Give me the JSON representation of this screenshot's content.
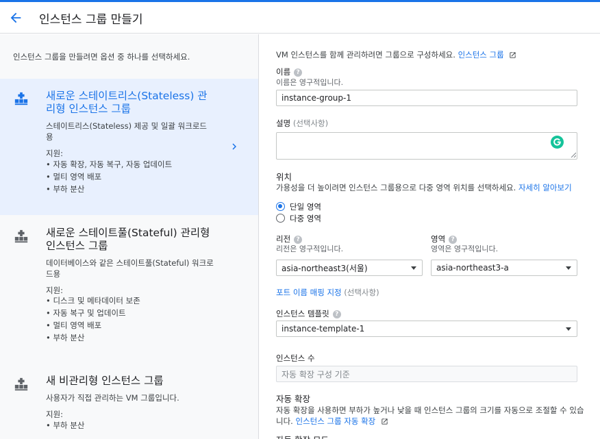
{
  "header": {
    "title": "인스턴스 그룹 만들기"
  },
  "left": {
    "intro": "인스턴스 그룹을 만들려면 옵션 중 하나를 선택하세요.",
    "options": [
      {
        "title": "새로운 스테이트리스(Stateless) 관리형 인스턴스 그룹",
        "desc": "스테이트리스(Stateless) 제공 및 일괄 워크로드용",
        "support": "지원:",
        "features": [
          "• 자동 확장, 자동 복구, 자동 업데이트",
          "• 멀티 영역 배포",
          "• 부하 분산"
        ]
      },
      {
        "title": "새로운 스테이트풀(Stateful) 관리형 인스턴스 그룹",
        "desc": "데이터베이스와 같은 스테이트풀(Stateful) 워크로드용",
        "support": "지원:",
        "features": [
          "• 디스크 및 메타데이터 보존",
          "• 자동 복구 및 업데이트",
          "• 멀티 영역 배포",
          "• 부하 분산"
        ]
      },
      {
        "title": "새 비관리형 인스턴스 그룹",
        "desc": "사용자가 직접 관리하는 VM 그룹입니다.",
        "support": "지원:",
        "features": [
          "• 부하 분산"
        ]
      }
    ]
  },
  "form": {
    "intro": "VM 인스턴스를 함께 관리하려면 그룹으로 구성하세요.",
    "intro_link": "인스턴스 그룹",
    "name_label": "이름",
    "name_hint": "이름은 영구적입니다.",
    "name_value": "instance-group-1",
    "desc_label": "설명",
    "desc_optional": "(선택사항)",
    "location_label": "위치",
    "location_desc": "가용성을 더 높이려면 인스턴스 그룹용으로 다중 영역 위치를 선택하세요.",
    "location_link": "자세히 알아보기",
    "single_zone": "단일 영역",
    "multi_zone": "다중 영역",
    "region_label": "리전",
    "region_hint": "리전은 영구적입니다.",
    "region_value": "asia-northeast3(서울)",
    "zone_label": "영역",
    "zone_hint": "영역은 영구적입니다.",
    "zone_value": "asia-northeast3-a",
    "port_link": "포트 이름 매핑 지정",
    "port_optional": "(선택사항)",
    "template_label": "인스턴스 템플릿",
    "template_value": "instance-template-1",
    "count_label": "인스턴스 수",
    "count_placeholder": "자동 확장 구성 기준",
    "autoscale_label": "자동 확장",
    "autoscale_desc1": "자동 확장을 사용하면 부하가 높거나 낮을 때 인스턴스 그룹의 크기를 자동으로 조절할 수 있습",
    "autoscale_desc2": "니다.",
    "autoscale_link": "인스턴스 그룹 자동 확장",
    "autoscale_mode_label": "자동 확장 모드"
  },
  "colors": {
    "accent": "#1a73e8",
    "selected_bg": "#e8f0fe",
    "panel_bg": "#f8f9fa"
  },
  "icons": {
    "back": "arrow-left-icon",
    "group": "instance-group-icon",
    "chevron": "chevron-right-icon",
    "help": "help-icon",
    "external": "external-link-icon",
    "grammarly": "grammarly-icon"
  }
}
